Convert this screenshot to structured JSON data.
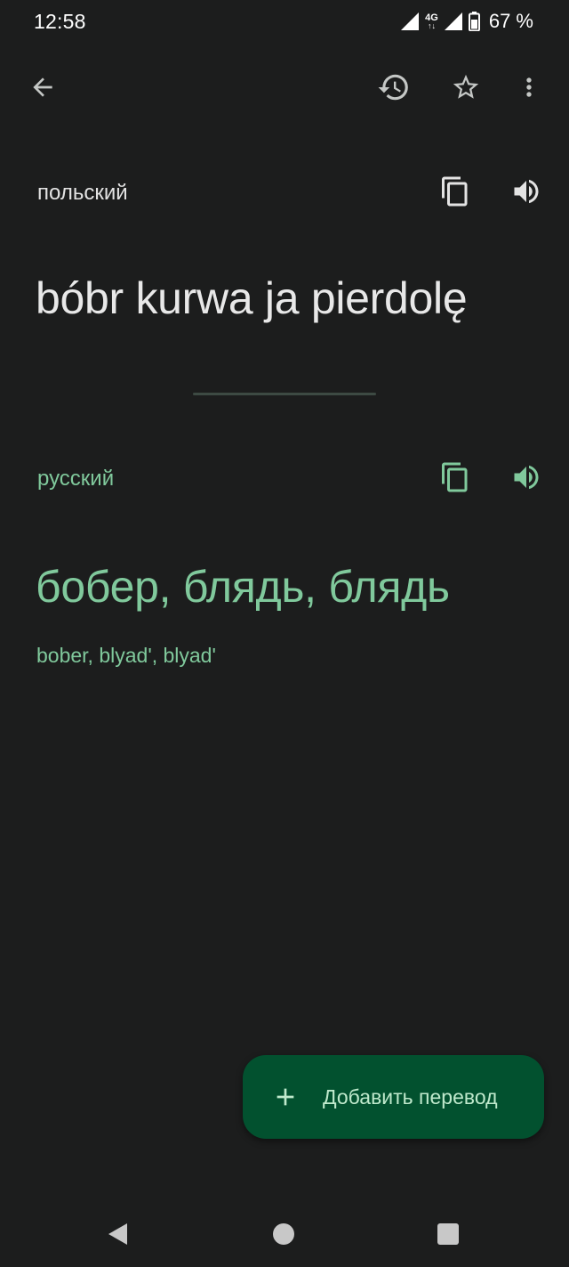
{
  "status_bar": {
    "time": "12:58",
    "network_type": "4G",
    "battery_percent": "67 %",
    "icons": [
      "signal-icon",
      "network-4g-icon",
      "signal-icon",
      "battery-icon"
    ]
  },
  "app_bar": {
    "icons": [
      "back-arrow-icon",
      "history-icon",
      "star-outline-icon",
      "more-vert-icon"
    ]
  },
  "source": {
    "language": "польский",
    "text": "bóbr kurwa ja pierdolę",
    "icons": [
      "copy-icon",
      "speaker-icon"
    ]
  },
  "target": {
    "language": "русский",
    "text": "бобер, блядь, блядь",
    "transliteration": "bober, blyad', blyad'",
    "icons": [
      "copy-icon",
      "speaker-icon"
    ]
  },
  "fab": {
    "label": "Добавить перевод",
    "icon": "plus-icon"
  },
  "nav_bar": {
    "icons": [
      "nav-back-icon",
      "nav-home-icon",
      "nav-recents-icon"
    ]
  },
  "colors": {
    "background": "#1c1d1d",
    "accent_green": "#80c99c",
    "fab_background": "#02512f",
    "fab_text": "#bfe9cc",
    "divider": "#3d4a43"
  }
}
